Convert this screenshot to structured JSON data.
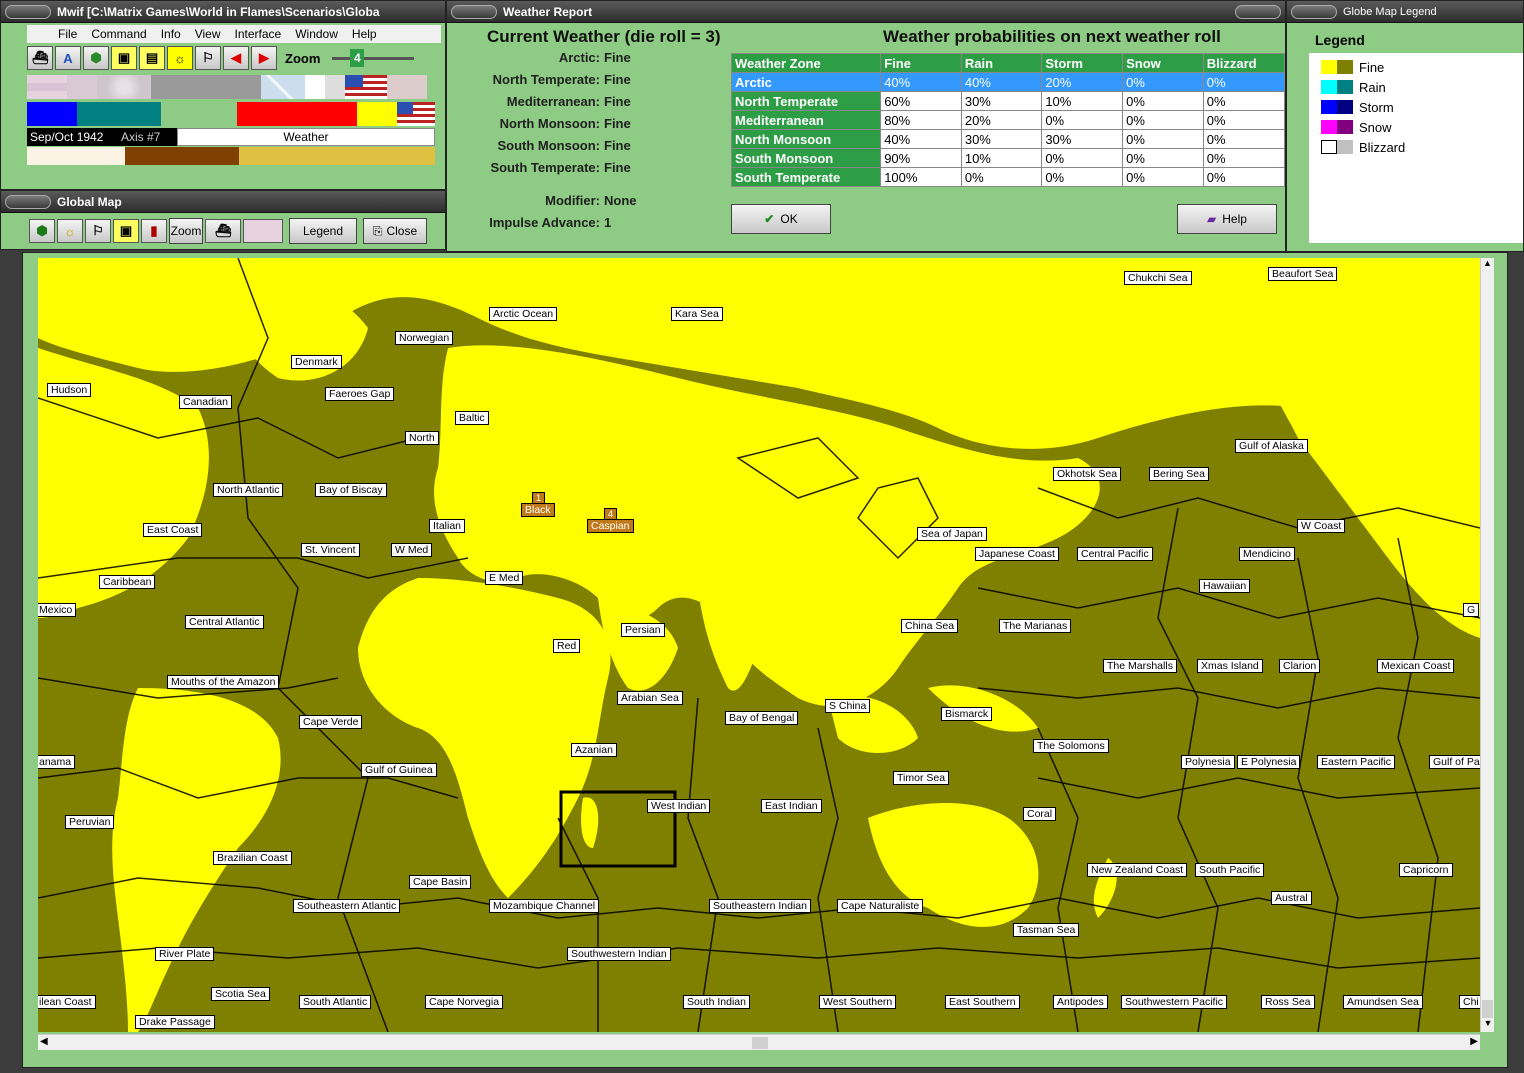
{
  "mwif": {
    "title": "Mwif [C:\\Matrix Games\\World in Flames\\Scenarios\\Globa",
    "menu": [
      "File",
      "Command",
      "Info",
      "View",
      "Interface",
      "Window",
      "Help"
    ],
    "zoom_label": "Zoom",
    "zoom_value": "4",
    "date": "Sep/Oct 1942",
    "impulse": "Axis #7",
    "mode": "Weather"
  },
  "global_map": {
    "title": "Global Map",
    "zoom_btn": "Zoom",
    "legend_btn": "Legend",
    "close_btn": "Close"
  },
  "weather": {
    "title": "Weather Report",
    "heading": "Current Weather (die roll = 3)",
    "prob_heading": "Weather probabilities on next weather roll",
    "current": [
      {
        "zone": "Arctic:",
        "value": "Fine"
      },
      {
        "zone": "North Temperate:",
        "value": "Fine"
      },
      {
        "zone": "Mediterranean:",
        "value": "Fine"
      },
      {
        "zone": "North Monsoon:",
        "value": "Fine"
      },
      {
        "zone": "South Monsoon:",
        "value": "Fine"
      },
      {
        "zone": "South Temperate:",
        "value": "Fine"
      }
    ],
    "modifier_label": "Modifier:",
    "modifier_value": "None",
    "impulse_label": "Impulse Advance:",
    "impulse_value": "1",
    "columns": [
      "Weather Zone",
      "Fine",
      "Rain",
      "Storm",
      "Snow",
      "Blizzard"
    ],
    "rows": [
      [
        "Arctic",
        "40%",
        "40%",
        "20%",
        "0%",
        "0%"
      ],
      [
        "North Temperate",
        "60%",
        "30%",
        "10%",
        "0%",
        "0%"
      ],
      [
        "Mediterranean",
        "80%",
        "20%",
        "0%",
        "0%",
        "0%"
      ],
      [
        "North Monsoon",
        "40%",
        "30%",
        "30%",
        "0%",
        "0%"
      ],
      [
        "South Monsoon",
        "90%",
        "10%",
        "0%",
        "0%",
        "0%"
      ],
      [
        "South Temperate",
        "100%",
        "0%",
        "0%",
        "0%",
        "0%"
      ]
    ],
    "ok_label": "OK",
    "help_label": "Help"
  },
  "legend": {
    "title": "Globe Map Legend",
    "heading": "Legend",
    "items": [
      {
        "label": "Fine",
        "c1": "#ffff00",
        "c2": "#808000"
      },
      {
        "label": "Rain",
        "c1": "#00ffff",
        "c2": "#008080"
      },
      {
        "label": "Storm",
        "c1": "#0000ff",
        "c2": "#000080"
      },
      {
        "label": "Snow",
        "c1": "#ff00ff",
        "c2": "#800080"
      },
      {
        "label": "Blizzard",
        "c1": "#ffffff",
        "c2": "#c0c0c0"
      }
    ]
  },
  "map_labels": {
    "arctic_ocean": "Arctic Ocean",
    "kara_sea": "Kara Sea",
    "chukchi_sea": "Chukchi Sea",
    "beaufort_sea": "Beaufort Sea",
    "norwegian": "Norwegian",
    "denmark": "Denmark",
    "hudson": "Hudson",
    "canadian": "Canadian",
    "faeroes_gap": "Faeroes Gap",
    "baltic": "Baltic",
    "north": "North",
    "north_atlantic": "North Atlantic",
    "bay_of_biscay": "Bay of Biscay",
    "black_num": "1",
    "black": "Black",
    "caspian_num": "4",
    "caspian": "Caspian",
    "east_coast": "East Coast",
    "italian": "Italian",
    "st_vincent": "St. Vincent",
    "w_med": "W Med",
    "e_med": "E Med",
    "caribbean": "Caribbean",
    "mexico": "Mexico",
    "central_atlantic": "Central Atlantic",
    "persian": "Persian",
    "red": "Red",
    "mouths_amazon": "Mouths of the Amazon",
    "arabian_sea": "Arabian Sea",
    "cape_verde": "Cape Verde",
    "bay_of_bengal": "Bay of Bengal",
    "s_china": "S China",
    "bismarck": "Bismarck",
    "azanian": "Azanian",
    "panama": "anama",
    "gulf_of_guinea": "Gulf of Guinea",
    "the_solomons": "The Solomons",
    "timor_sea": "Timor Sea",
    "polynesia": "Polynesia",
    "e_polynesia": "E Polynesia",
    "eastern_pacific": "Eastern Pacific",
    "gulf_of_pa": "Gulf of Pa",
    "west_indian": "West Indian",
    "east_indian": "East Indian",
    "peruvian": "Peruvian",
    "coral": "Coral",
    "brazilian_coast": "Brazilian Coast",
    "cape_basin": "Cape Basin",
    "new_zealand_coast": "New Zealand Coast",
    "south_pacific": "South Pacific",
    "capricorn": "Capricorn",
    "austral": "Austral",
    "southeastern_atlantic": "Southeastern Atlantic",
    "mozambique_channel": "Mozambique Channel",
    "southeastern_indian": "Southeastern Indian",
    "cape_naturaliste": "Cape Naturaliste",
    "tasman_sea": "Tasman Sea",
    "southwestern_indian": "Southwestern Indian",
    "river_plate": "River Plate",
    "scotia_sea": "Scotia Sea",
    "chilean_coast": "ilean Coast",
    "south_atlantic": "South Atlantic",
    "cape_norvegia": "Cape Norvegia",
    "south_indian": "South Indian",
    "west_southern": "West Southern",
    "east_southern": "East Southern",
    "antipodes": "Antipodes",
    "southwestern_pacific": "Southwestern Pacific",
    "ross_sea": "Ross Sea",
    "amundsen_sea": "Amundsen Sea",
    "chi": "Chi",
    "drake_passage": "Drake Passage",
    "okhotsk_sea": "Okhotsk Sea",
    "bering_sea": "Bering Sea",
    "gulf_of_alaska": "Gulf of Alaska",
    "sea_of_japan": "Sea of Japan",
    "w_coast": "W Coast",
    "japanese_coast": "Japanese Coast",
    "central_pacific": "Central Pacific",
    "mendicino": "Mendicino",
    "hawaiian": "Hawaiian",
    "g": "G",
    "china_sea": "China Sea",
    "the_marianas": "The Marianas",
    "the_marshalls": "The Marshalls",
    "xmas_island": "Xmas Island",
    "clarion": "Clarion",
    "mexican_coast": "Mexican Coast"
  },
  "colors": {
    "panel": "#8ecb84",
    "fine_land": "#ffff00",
    "fine_sea": "#808000",
    "header_green": "#2e9e46",
    "selection": "#3399ff"
  }
}
